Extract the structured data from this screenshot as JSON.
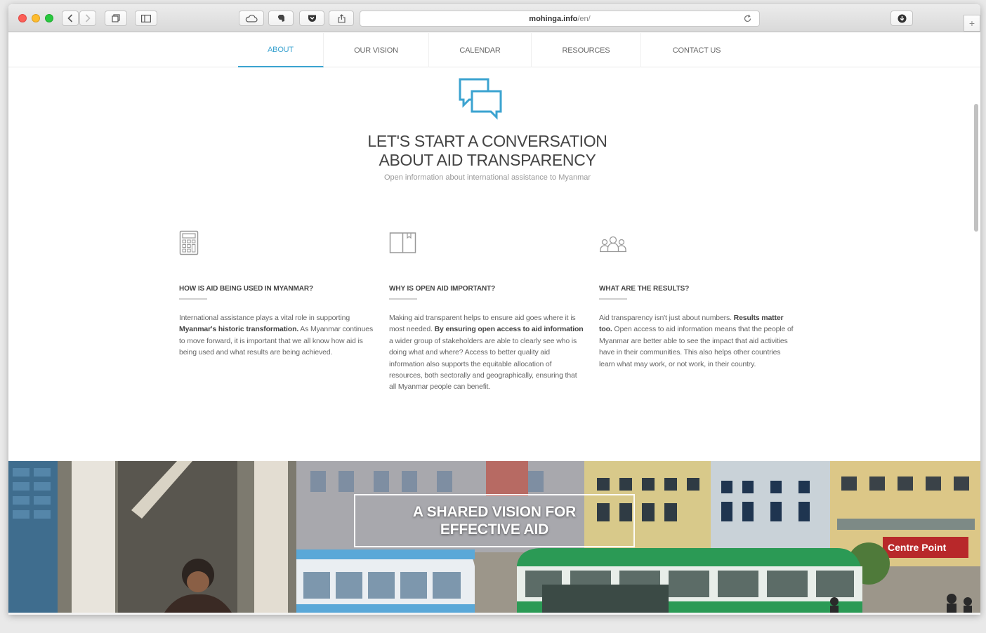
{
  "browser": {
    "url_domain": "mohinga.info",
    "url_path": "/en/"
  },
  "nav": {
    "items": [
      {
        "label": "ABOUT",
        "active": true
      },
      {
        "label": "OUR VISION",
        "active": false
      },
      {
        "label": "CALENDAR",
        "active": false
      },
      {
        "label": "RESOURCES",
        "active": false
      },
      {
        "label": "CONTACT US",
        "active": false
      }
    ]
  },
  "hero": {
    "title_line1": "LET'S START A CONVERSATION",
    "title_line2": "ABOUT AID TRANSPARENCY",
    "subtitle": "Open information about international assistance to Myanmar"
  },
  "columns": [
    {
      "icon": "calculator-icon",
      "title": "HOW IS AID BEING USED IN MYANMAR?",
      "body_1": "International assistance plays a vital role in supporting ",
      "body_bold": "Myanmar's historic transformation.",
      "body_2": " As Myanmar continues to move forward, it is important that we all know how aid is being used and what results are being achieved."
    },
    {
      "icon": "book-icon",
      "title": "WHY IS OPEN AID IMPORTANT?",
      "body_1": "Making aid transparent helps to ensure aid goes where it is most needed. ",
      "body_bold": "By ensuring open access to aid information",
      "body_2": " a wider group of stakeholders are able to clearly see who is doing what and where? Access to better quality aid information also supports the equitable allocation of resources, both sectorally and geographically, ensuring that all Myanmar people can benefit."
    },
    {
      "icon": "people-icon",
      "title": "WHAT ARE THE RESULTS?",
      "body_1": "Aid transparency isn't just about numbers. ",
      "body_bold": "Results matter too.",
      "body_2": " Open access to aid information means that the people of Myanmar are better able to see the impact that aid activities have in their communities. This also helps other countries learn what may work, or not work, in their country."
    }
  ],
  "banner": {
    "title_line1": "A SHARED VISION FOR",
    "title_line2": "EFFECTIVE AID",
    "shop_sign": "Centre Point"
  },
  "colors": {
    "accent": "#3ba3d0",
    "bus_green": "#2b9a55",
    "bus_blue": "#5aa8d8"
  }
}
